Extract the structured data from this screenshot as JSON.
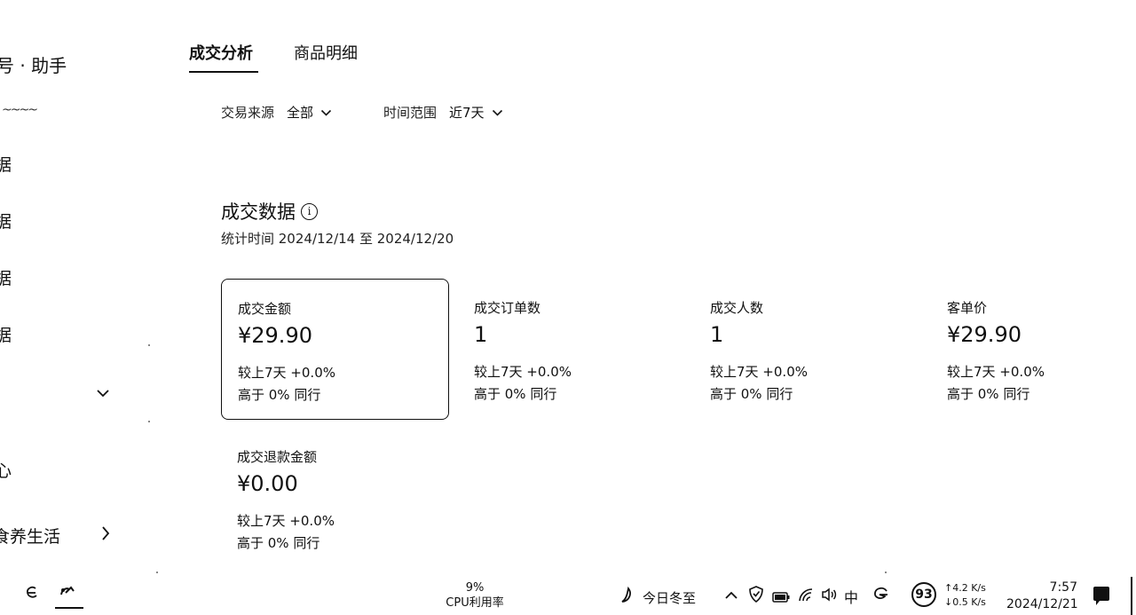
{
  "sidebar": {
    "title": "号 · 助手",
    "squiggle": "~~~~",
    "items": [
      {
        "label": "据"
      },
      {
        "label": "据"
      },
      {
        "label": "据"
      },
      {
        "label": "据"
      },
      {
        "label": "心"
      },
      {
        "label": "食养生活"
      }
    ]
  },
  "tabs": [
    {
      "label": "成交分析",
      "active": true
    },
    {
      "label": "商品明细",
      "active": false
    }
  ],
  "filters": {
    "source": {
      "label": "交易来源",
      "value": "全部"
    },
    "time": {
      "label": "时间范围",
      "value": "近7天"
    }
  },
  "section": {
    "title": "成交数据",
    "stat_time": "统计时间 2024/12/14 至 2024/12/20"
  },
  "metrics": [
    {
      "name": "成交金额",
      "value": "¥29.90",
      "compare": "较上7天 +0.0%",
      "peer": "高于 0% 同行",
      "selected": true
    },
    {
      "name": "成交订单数",
      "value": "1",
      "compare": "较上7天 +0.0%",
      "peer": "高于 0% 同行",
      "selected": false
    },
    {
      "name": "成交人数",
      "value": "1",
      "compare": "较上7天 +0.0%",
      "peer": "高于 0% 同行",
      "selected": false
    },
    {
      "name": "客单价",
      "value": "¥29.90",
      "compare": "较上7天 +0.0%",
      "peer": "高于 0% 同行",
      "selected": false
    },
    {
      "name": "成交退款金额",
      "value": "¥0.00",
      "compare": "较上7天 +0.0%",
      "peer": "高于 0% 同行",
      "selected": false
    }
  ],
  "taskbar": {
    "cpu_percent": "9%",
    "cpu_label": "CPU利用率",
    "weather": "今日冬至",
    "ime": "中",
    "battery_badge": "93",
    "net_up": "↑4.2 K/s",
    "net_down": "↓0.5 K/s",
    "time": "7:57",
    "date": "2024/12/21"
  },
  "icons": {
    "info": "info-icon",
    "chevron_down": "chevron-down-icon",
    "chevron_right": "chevron-right-icon"
  }
}
